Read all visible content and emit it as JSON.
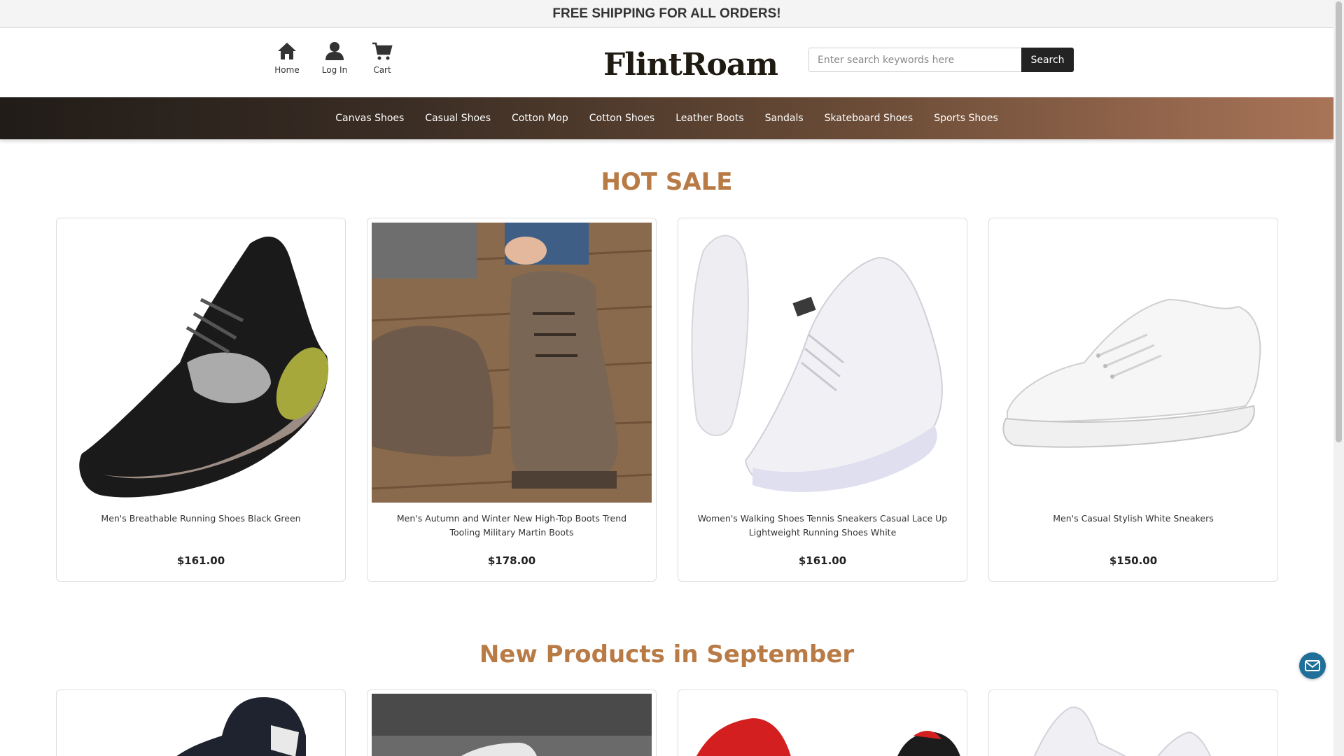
{
  "announcement": "FREE SHIPPING FOR ALL ORDERS!",
  "header": {
    "icons": [
      {
        "name": "home-icon",
        "label": "Home"
      },
      {
        "name": "user-icon",
        "label": "Log In"
      },
      {
        "name": "cart-icon",
        "label": "Cart"
      }
    ],
    "logo": {
      "part1": "Flint",
      "part2": "Roam"
    },
    "search": {
      "placeholder": "Enter search keywords here",
      "button": "Search"
    }
  },
  "nav": {
    "categories": [
      "Canvas Shoes",
      "Casual Shoes",
      "Cotton Mop",
      "Cotton Shoes",
      "Leather Boots",
      "Sandals",
      "Skateboard Shoes",
      "Sports Shoes"
    ]
  },
  "hot_sale": {
    "title": "HOT SALE",
    "products": [
      {
        "name": "Men's Breathable Running Shoes Black Green",
        "price": "$161.00"
      },
      {
        "name": "Men's Autumn and Winter New High-Top Boots Trend Tooling Military Martin Boots",
        "price": "$178.00"
      },
      {
        "name": "Women's Walking Shoes Tennis Sneakers Casual Lace Up Lightweight Running Shoes White",
        "price": "$161.00"
      },
      {
        "name": "Men's Casual Stylish White Sneakers",
        "price": "$150.00"
      }
    ]
  },
  "new_products": {
    "title": "New Products in September"
  },
  "colors": {
    "accent": "#b97b46",
    "button": "#232323"
  }
}
